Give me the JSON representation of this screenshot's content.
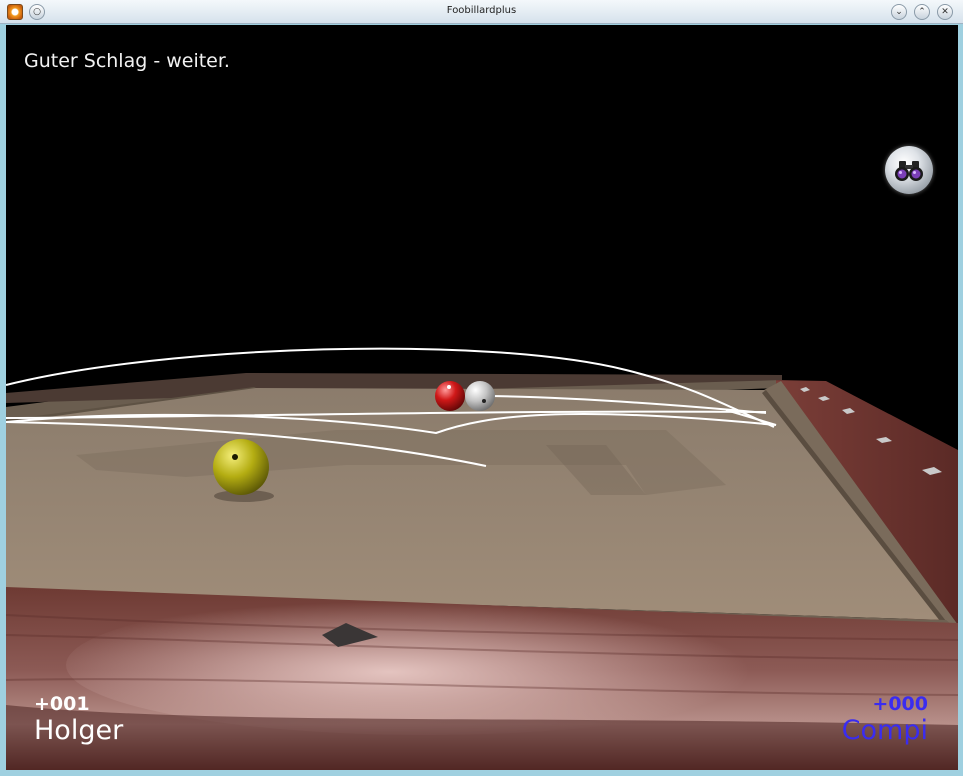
{
  "window": {
    "title": "Foobillardplus",
    "menu_button_glyph": "○",
    "minimize_glyph": "⌄",
    "maximize_glyph": "⌃",
    "close_glyph": "✕"
  },
  "game": {
    "status_message": "Guter Schlag - weiter.",
    "players": [
      {
        "name": "Holger",
        "score": "+001",
        "color": "#ffffff"
      },
      {
        "name": "Compi",
        "score": "+000",
        "color": "#3a2cf0"
      }
    ],
    "balls": [
      {
        "name": "yellow-ball",
        "color": "#c9c21a"
      },
      {
        "name": "red-ball",
        "color": "#d01818"
      },
      {
        "name": "white-ball",
        "color": "#d8d8d8"
      }
    ],
    "view_button_icon": "binoculars-icon"
  }
}
